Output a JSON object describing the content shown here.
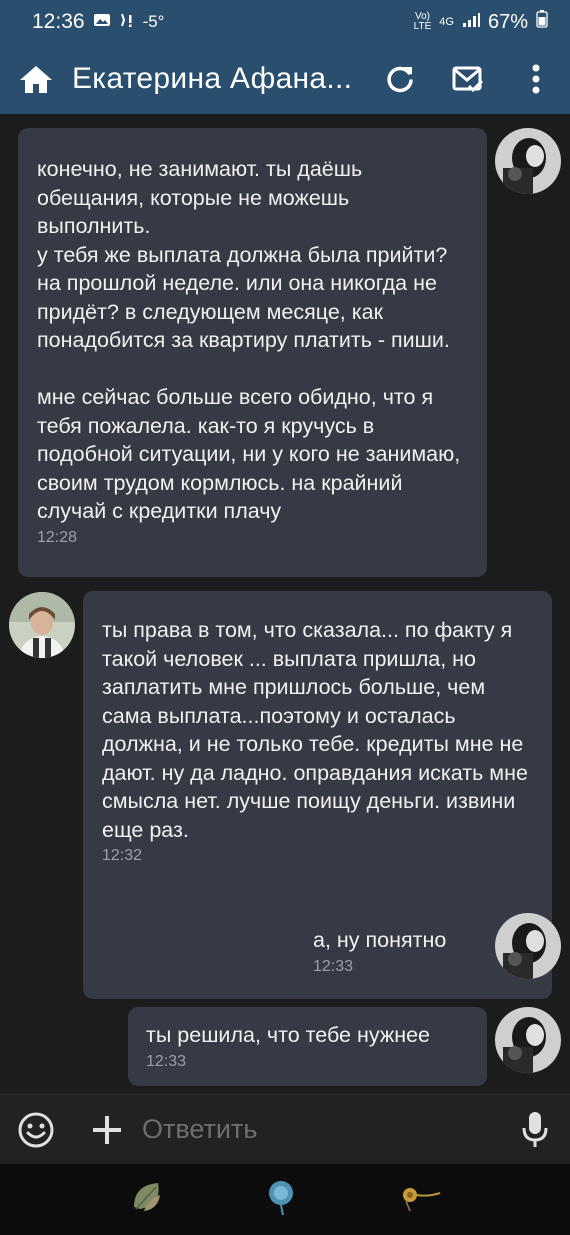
{
  "status_bar": {
    "time": "12:36",
    "temperature": "-5°",
    "network": "4G",
    "volte": "VoLTE",
    "battery": "67%"
  },
  "header": {
    "title": "Екатерина Афана...",
    "icons": [
      "home-icon",
      "refresh-icon",
      "mail-check-icon",
      "more-vertical-icon"
    ],
    "color": "#2a4e6e"
  },
  "messages": [
    {
      "side": "right",
      "text": "конечно, не занимают. ты даёшь обещания, которые не можешь выполнить.\nу тебя же выплата должна была прийти? на прошлой неделе. или она никогда не придёт? в следующем месяце, как понадобится за квартиру платить - пиши.\n\nмне сейчас больше всего обидно, что я тебя пожалела. как-то я кручусь в подобной ситуации, ни у кого не занимаю, своим трудом кормлюсь. на крайний случай с кредитки плачу",
      "time": "12:28"
    },
    {
      "side": "left",
      "text": "ты права в том, что сказала... по факту я такой человек ... выплата пришла, но заплатить мне пришлось больше, чем сама выплата...поэтому и осталась должна, и не только тебе. кредиты мне не дают. ну да ладно. оправдания искать мне смысла нет. лучше поищу деньги. извини еще раз.",
      "time": "12:32"
    },
    {
      "side": "right",
      "text": "а, ну понятно",
      "time": "12:33"
    },
    {
      "side": "right",
      "text": "ты решила, что тебе нужнее",
      "time": "12:33"
    }
  ],
  "composer": {
    "placeholder": "Ответить"
  },
  "colors": {
    "bubble": "#353a44",
    "background": "#1c1c1c",
    "time": "#9aa0a8"
  }
}
